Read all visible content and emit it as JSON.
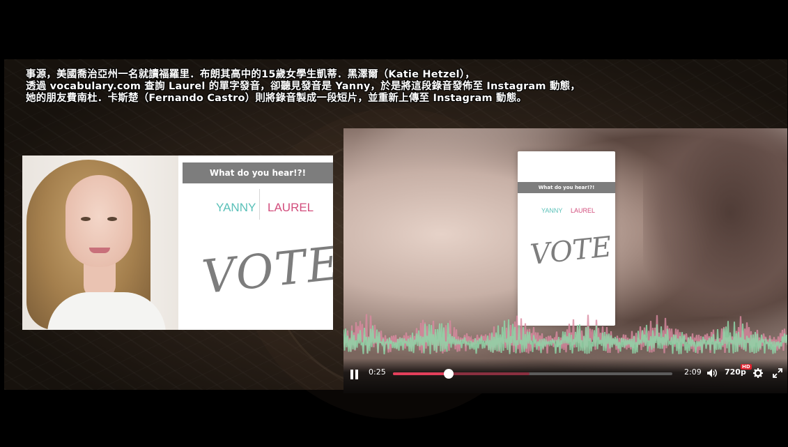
{
  "caption": {
    "line1": "事源，美國喬治亞州一名就讀福羅里．布朗其高中的15歲女學生凱蒂．黑澤爾（Katie Hetzel），",
    "line2": "透過 vocabulary.com 查詢 Laurel 的單字發音，卻聽見發音是 Yanny，於是將這段錄音發佈至 Instagram 動態，",
    "line3": "她的朋友費南杜．卡斯楚（Fernando Castro）則將錄音製成一段短片，並重新上傳至 Instagram 動態。"
  },
  "left_card": {
    "banner": "What do you hear!?!",
    "option_a": "YANNY",
    "option_b": "LAUREL",
    "vote": "VOTE"
  },
  "player": {
    "phone": {
      "banner": "What do you hear!?!",
      "option_a": "YANNY",
      "option_b": "LAUREL",
      "vote": "VOTE"
    },
    "current_time": "0:25",
    "duration": "2:09",
    "played_fraction": 0.2,
    "loaded_fraction": 0.49,
    "quality": "720p",
    "quality_badge": "HD",
    "icons": {
      "play_pause": "pause-icon",
      "volume": "volume-icon",
      "settings": "gear-icon",
      "fullscreen": "fullscreen-icon"
    },
    "colors": {
      "progress": "#e23f5b",
      "wave_green": "#8fd6a8",
      "wave_pink": "#d98aa0"
    }
  }
}
